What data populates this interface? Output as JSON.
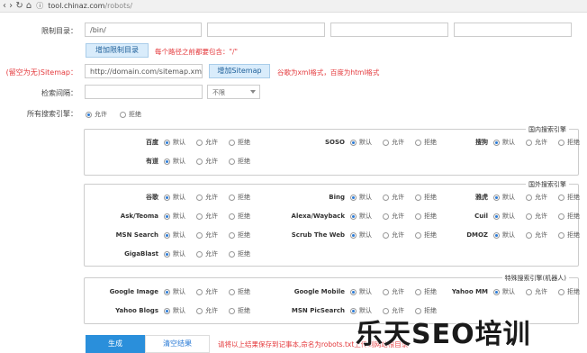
{
  "browser": {
    "nav_glyphs": "‹ › ↻ ⌂",
    "info_glyph": "ⓘ",
    "url_host": "tool.chinaz.com",
    "url_path": "/robots/"
  },
  "form": {
    "restrict_dir": {
      "label": "限制目录：",
      "values": [
        "/bin/",
        "",
        "",
        ""
      ],
      "add_button": "增加限制目录",
      "hint": "每个路径之前都要包含：\"/\""
    },
    "sitemap": {
      "label": "(留空为无)Sitemap：",
      "value": "http://domain.com/sitemap.xml",
      "add_button": "增加Sitemap",
      "hint": "谷歌为xml格式，百度为html格式"
    },
    "crawl_delay": {
      "label": "检索间隔：",
      "value": "",
      "select_value": "不限"
    },
    "all_engines": {
      "label": "所有搜索引擎：",
      "options": [
        "允许",
        "拒绝"
      ],
      "selected": 0
    }
  },
  "option_labels": [
    "默认",
    "允许",
    "拒绝"
  ],
  "groups": [
    {
      "title": "国内搜索引擎",
      "engines": [
        {
          "name": "百度",
          "selected": 0
        },
        {
          "name": "SOSO",
          "selected": 0
        },
        {
          "name": "搜狗",
          "selected": 0
        },
        {
          "name": "有道",
          "selected": 0
        }
      ]
    },
    {
      "title": "国外搜索引擎",
      "engines": [
        {
          "name": "谷歌",
          "selected": 0
        },
        {
          "name": "Bing",
          "selected": 0
        },
        {
          "name": "雅虎",
          "selected": 0
        },
        {
          "name": "Ask/Teoma",
          "selected": 0
        },
        {
          "name": "Alexa/Wayback",
          "selected": 0
        },
        {
          "name": "Cuil",
          "selected": 0
        },
        {
          "name": "MSN Search",
          "selected": 0
        },
        {
          "name": "Scrub The Web",
          "selected": 0
        },
        {
          "name": "DMOZ",
          "selected": 0
        },
        {
          "name": "GigaBlast",
          "selected": 0
        }
      ]
    },
    {
      "title": "特殊搜索引擎(机器人)",
      "engines": [
        {
          "name": "Google Image",
          "selected": 0
        },
        {
          "name": "Google Mobile",
          "selected": 0
        },
        {
          "name": "Yahoo MM",
          "selected": 0
        },
        {
          "name": "Yahoo Blogs",
          "selected": 0
        },
        {
          "name": "MSN PicSearch",
          "selected": 0
        }
      ]
    }
  ],
  "actions": {
    "generate": "生成",
    "clear": "清空结果",
    "hint": "请将以上结果保存到记事本,命名为robots.txt上传到网站根目录"
  },
  "watermark": "乐天SEO培训",
  "colors": {
    "accent": "#2a8fdb",
    "hint_red": "#e4393c"
  }
}
